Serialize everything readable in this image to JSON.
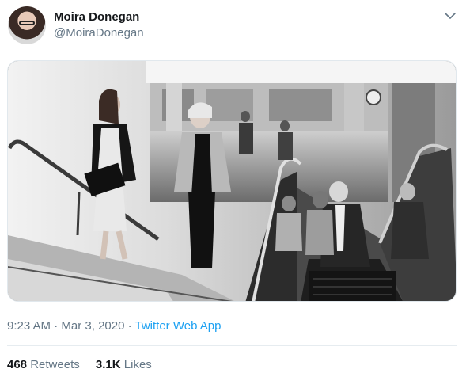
{
  "user": {
    "name": "Moira Donegan",
    "handle": "@MoiraDonegan"
  },
  "icons": {
    "menu": "chevron-down-icon"
  },
  "media": {
    "description": "black-and-white photo of people on escalator and stairs"
  },
  "meta": {
    "time": "9:23 AM",
    "sep1": " · ",
    "date": "Mar 3, 2020",
    "sep2": " · ",
    "app": "Twitter Web App"
  },
  "stats": {
    "retweets_count": "468",
    "retweets_label": "Retweets",
    "likes_count": "3.1K",
    "likes_label": "Likes"
  },
  "colors": {
    "link": "#1da1f2",
    "secondary_text": "#657786",
    "primary_text": "#14171a"
  }
}
